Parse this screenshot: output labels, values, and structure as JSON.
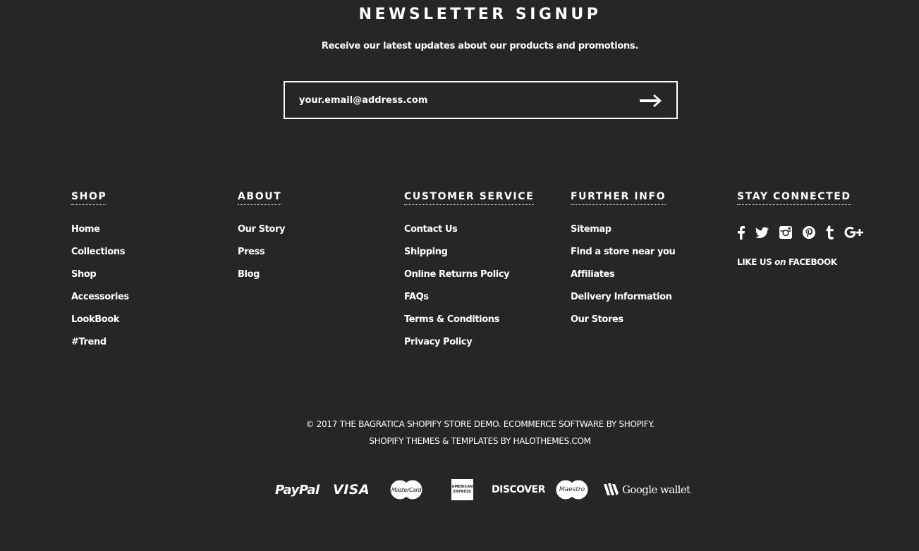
{
  "newsletter": {
    "title": "NEWSLETTER SIGNUP",
    "subtitle": "Receive our latest updates about our products and promotions.",
    "email_placeholder": "your.email@address.com",
    "submit_icon": "arrow-right-icon"
  },
  "columns": [
    {
      "title": "SHOP",
      "links": [
        "Home",
        "Collections",
        "Shop",
        "Accessories",
        "LookBook",
        "#Trend"
      ]
    },
    {
      "title": "ABOUT",
      "links": [
        "Our Story",
        "Press",
        "Blog"
      ]
    },
    {
      "title": "CUSTOMER SERVICE",
      "links": [
        "Contact Us",
        "Shipping",
        "Online Returns Policy",
        "FAQs",
        "Terms & Conditions",
        "Privacy Policy"
      ]
    },
    {
      "title": "FURTHER INFO",
      "links": [
        "Sitemap",
        "Find a store near you",
        "Affiliates",
        "Delivery Information",
        "Our Stores"
      ]
    }
  ],
  "stay_connected": {
    "title": "STAY CONNECTED",
    "icons": [
      "facebook-icon",
      "twitter-icon",
      "instagram-icon",
      "pinterest-icon",
      "tumblr-icon",
      "google-plus-icon"
    ],
    "like_prefix": "LIKE US",
    "like_on": "on",
    "like_suffix": "FACEBOOK"
  },
  "copyright": {
    "line1": "© 2017 THE BAGRATICA SHOPIFY STORE DEMO. ECOMMERCE SOFTWARE BY SHOPIFY.",
    "line2": "SHOPIFY THEMES & TEMPLATES BY HALOTHEMES.COM"
  },
  "payments": {
    "paypal": "PayPal",
    "visa": "VISA",
    "mastercard": "MasterCard",
    "amex": "AMERICAN EXPRESS",
    "discover": "DISCOVER",
    "maestro": "Maestro",
    "google_wallet": "Google wallet"
  },
  "colors": {
    "background": "#262626",
    "text": "#ffffff"
  }
}
